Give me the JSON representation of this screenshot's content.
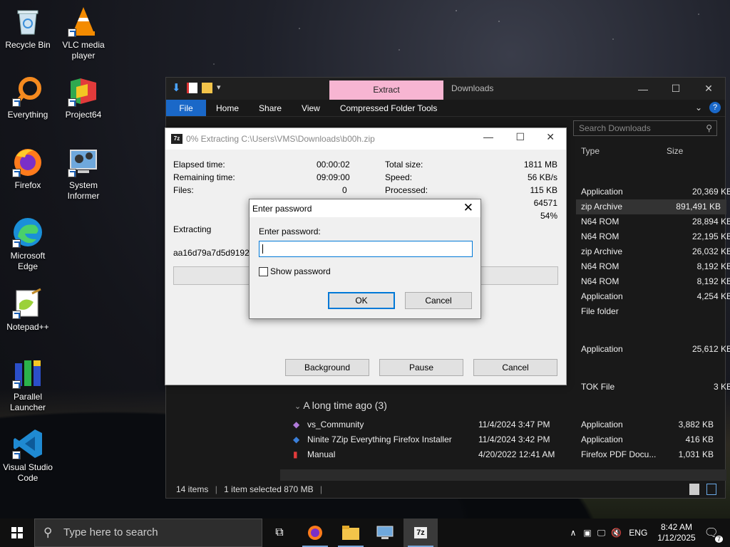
{
  "desktop_icons": [
    {
      "label": "Recycle Bin",
      "icon": "recycle-bin-icon"
    },
    {
      "label": "VLC media player",
      "icon": "vlc-icon"
    },
    {
      "label": "Everything",
      "icon": "everything-icon"
    },
    {
      "label": "Project64",
      "icon": "project64-icon"
    },
    {
      "label": "Firefox",
      "icon": "firefox-icon"
    },
    {
      "label": "System Informer",
      "icon": "system-informer-icon"
    },
    {
      "label": "Microsoft Edge",
      "icon": "edge-icon"
    },
    {
      "label": "Notepad++",
      "icon": "notepadpp-icon"
    },
    {
      "label": "Parallel Launcher",
      "icon": "parallel-launcher-icon"
    },
    {
      "label": "Visual Studio Code",
      "icon": "vscode-icon"
    }
  ],
  "explorer": {
    "extract_tab": "Extract",
    "title": "Downloads",
    "ribbon_tabs": [
      "File",
      "Home",
      "Share",
      "View",
      "Compressed Folder Tools"
    ],
    "search_placeholder": "Search Downloads",
    "columns": [
      "Type",
      "Size"
    ],
    "rows": [
      {
        "type": "Application",
        "size": "20,369 KB"
      },
      {
        "type": "zip Archive",
        "size": "891,491 KB"
      },
      {
        "type": "N64 ROM",
        "size": "28,894 KB"
      },
      {
        "type": "N64 ROM",
        "size": "22,195 KB"
      },
      {
        "type": "zip Archive",
        "size": "26,032 KB"
      },
      {
        "type": "N64 ROM",
        "size": "8,192 KB"
      },
      {
        "type": "N64 ROM",
        "size": "8,192 KB"
      },
      {
        "type": "Application",
        "size": "4,254 KB"
      },
      {
        "type": "File folder",
        "size": ""
      },
      {
        "type": "Application",
        "size": "25,612 KB"
      },
      {
        "type": "TOK File",
        "size": "3 KB"
      }
    ],
    "group_long_ago": "A long time ago (3)",
    "long_ago_rows": [
      {
        "name": "vs_Community",
        "date": "11/4/2024 3:47 PM",
        "type": "Application",
        "size": "3,882 KB"
      },
      {
        "name": "Ninite 7Zip Everything Firefox Installer",
        "date": "11/4/2024 3:42 PM",
        "type": "Application",
        "size": "416 KB"
      },
      {
        "name": "Manual",
        "date": "4/20/2022 12:41 AM",
        "type": "Firefox PDF Docu...",
        "size": "1,031 KB"
      }
    ],
    "status_items": "14 items",
    "status_selected": "1 item selected  870 MB"
  },
  "zip_dialog": {
    "title": "0% Extracting C:\\Users\\VMS\\Downloads\\b00h.zip",
    "elapsed_label": "Elapsed time:",
    "elapsed": "00:00:02",
    "remaining_label": "Remaining time:",
    "remaining": "09:09:00",
    "files_label": "Files:",
    "files": "0",
    "total_label": "Total size:",
    "total": "1811 MB",
    "speed_label": "Speed:",
    "speed": "56 KB/s",
    "processed_label": "Processed:",
    "processed": "115 KB",
    "unlabeled_value": "64571",
    "percent": "54%",
    "extracting_label": "Extracting",
    "current_file": "aa16d79a7d5d91927c",
    "btn_background": "Background",
    "btn_pause": "Pause",
    "btn_cancel": "Cancel"
  },
  "password_dialog": {
    "title": "Enter password",
    "label": "Enter password:",
    "value": "",
    "show_password": "Show password",
    "ok": "OK",
    "cancel": "Cancel"
  },
  "taskbar": {
    "search_placeholder": "Type here to search",
    "language": "ENG",
    "time": "8:42 AM",
    "date": "1/12/2025",
    "notifications": "7"
  },
  "colors": {
    "accent": "#0078d7",
    "extract_tab": "#f7b5d2",
    "file_tab": "#1a68c8"
  }
}
